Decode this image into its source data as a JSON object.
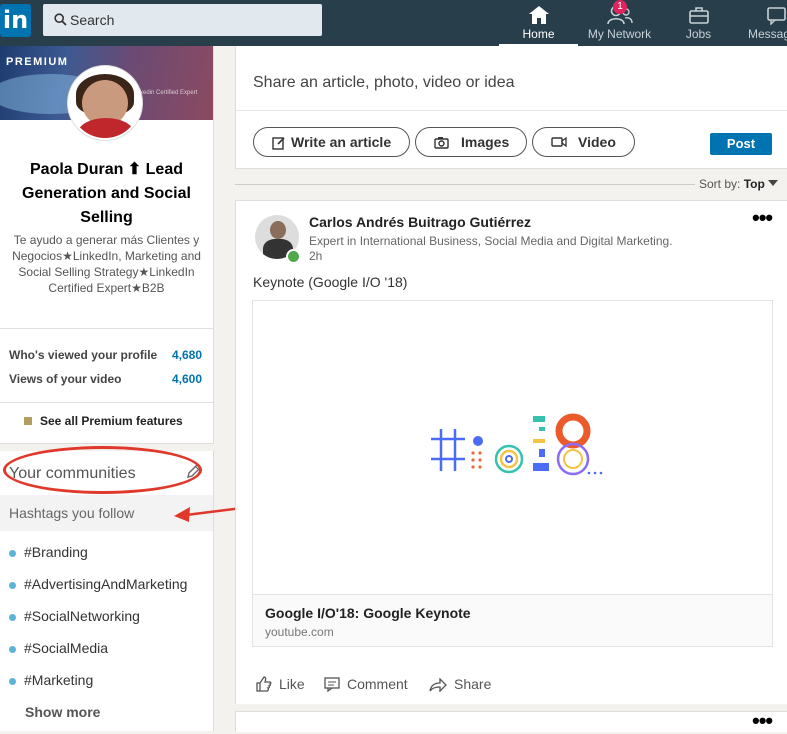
{
  "nav": {
    "logo": "in",
    "search_placeholder": "Search",
    "items": [
      {
        "label": "Home",
        "icon": "home-icon",
        "active": true
      },
      {
        "label": "My Network",
        "icon": "network-icon",
        "badge": "1"
      },
      {
        "label": "Jobs",
        "icon": "briefcase-icon"
      },
      {
        "label": "Messag",
        "icon": "messaging-icon"
      }
    ]
  },
  "profile": {
    "premium_label": "PREMIUM",
    "banner_fine": "kedin Certified Expert",
    "name": "Paola Duran ⬆ Lead Generation and Social Selling",
    "headline": "Te ayudo a generar más Clientes y Negocios★LinkedIn, Marketing and Social Selling Strategy★LinkedIn Certified Expert★B2B",
    "stats": [
      {
        "label": "Who's viewed your profile",
        "value": "4,680"
      },
      {
        "label": "Views of your video",
        "value": "4,600"
      }
    ],
    "premium_features": "See all Premium features"
  },
  "communities": {
    "title": "Your communities",
    "hashtags_header": "Hashtags you follow",
    "hashtags": [
      "#Branding",
      "#AdvertisingAndMarketing",
      "#SocialNetworking",
      "#SocialMedia",
      "#Marketing"
    ],
    "show_more": "Show more"
  },
  "share": {
    "prompt": "Share an article, photo, video or idea",
    "buttons": [
      "Write an article",
      "Images",
      "Video"
    ],
    "post": "Post"
  },
  "sort": {
    "label": "Sort by:",
    "value": "Top"
  },
  "post": {
    "author": "Carlos Andrés Buitrago Gutiérrez",
    "author_headline": "Expert in International Business, Social Media and Digital Marketing.",
    "time": "2h",
    "text": "Keynote (Google I/O '18)",
    "preview_title": "Google I/O'18: Google Keynote",
    "preview_domain": "youtube.com",
    "actions": [
      "Like",
      "Comment",
      "Share"
    ]
  },
  "colors": {
    "nav_bg": "#283e4a",
    "brand_blue": "#0073b1",
    "annotation_red": "#e0382a"
  }
}
